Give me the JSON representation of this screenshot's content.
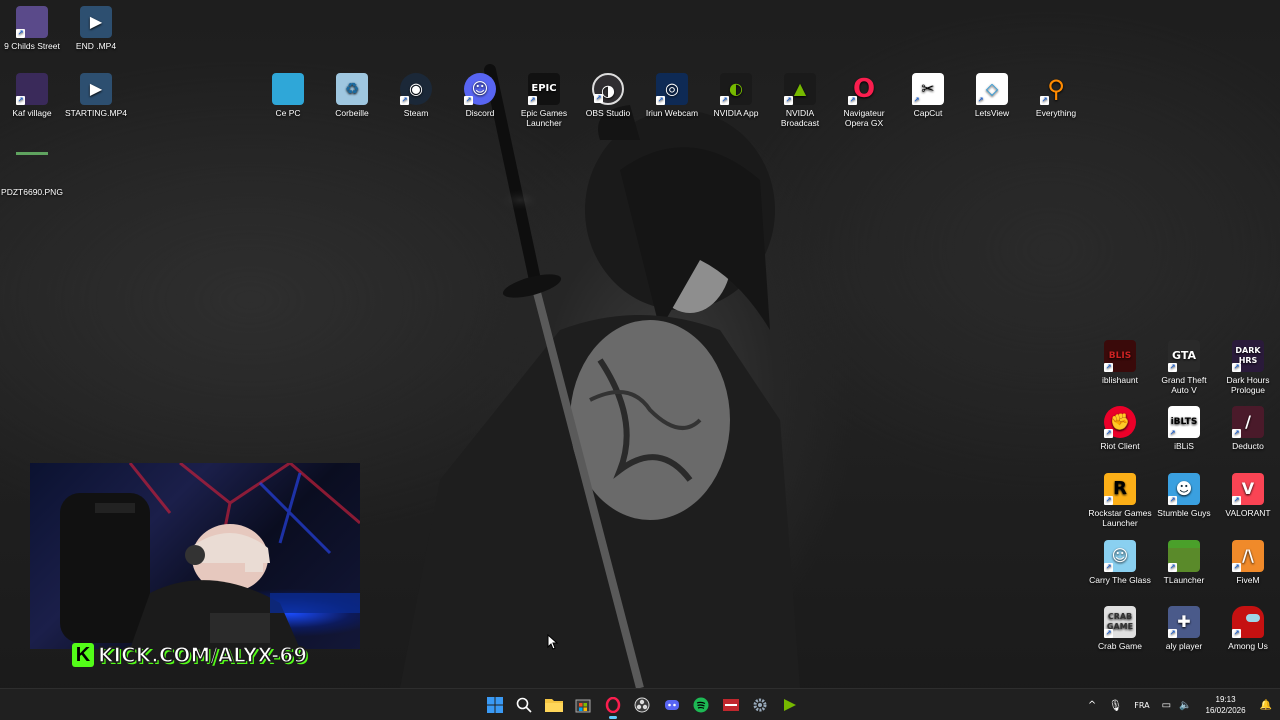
{
  "desktop": {
    "left_icons": [
      {
        "label": "9 Childs Street",
        "icon": "game-icon",
        "color": "#5a4a8a"
      },
      {
        "label": "END .MP4",
        "icon": "video-file-icon",
        "color": "#2d4f70"
      },
      {
        "label": "Kaf village",
        "icon": "game-icon",
        "color": "#3a2a5a"
      },
      {
        "label": "STARTING.MP4",
        "icon": "video-file-icon",
        "color": "#2d4f70"
      },
      {
        "label": "PDZT6690.PNG",
        "icon": "image-file-icon",
        "color": "#3a3a3a"
      }
    ],
    "top_icons": [
      {
        "label": "Ce PC",
        "icon": "monitor-icon",
        "color": "#2fa7d8"
      },
      {
        "label": "Corbeille",
        "icon": "recycle-bin-icon",
        "color": "#9fc7e0"
      },
      {
        "label": "Steam",
        "icon": "steam-icon",
        "color": "#1b2838"
      },
      {
        "label": "Discord",
        "icon": "discord-icon",
        "color": "#5865f2"
      },
      {
        "label": "Epic Games Launcher",
        "icon": "epic-games-icon",
        "color": "#111111"
      },
      {
        "label": "OBS Studio",
        "icon": "obs-icon",
        "color": "#302e31"
      },
      {
        "label": "Iriun Webcam",
        "icon": "webcam-icon",
        "color": "#0e2a55"
      },
      {
        "label": "NVIDIA App",
        "icon": "nvidia-icon",
        "color": "#76b900"
      },
      {
        "label": "NVIDIA Broadcast",
        "icon": "nvidia-broadcast-icon",
        "color": "#1a1a1a"
      },
      {
        "label": "Navigateur Opera GX",
        "icon": "opera-gx-icon",
        "color": "#fa1e4e"
      },
      {
        "label": "CapCut",
        "icon": "capcut-icon",
        "color": "#ffffff"
      },
      {
        "label": "LetsView",
        "icon": "letsview-icon",
        "color": "#ffffff"
      },
      {
        "label": "Everything",
        "icon": "search-magnifier-icon",
        "color": "#ff8a00"
      }
    ],
    "right_icons": [
      {
        "label": "iblishaunt",
        "icon": "game-icon",
        "color": "#3a0a0a"
      },
      {
        "label": "Grand Theft Auto V",
        "icon": "gta-icon",
        "color": "#2a2a2a"
      },
      {
        "label": "Dark Hours Prologue",
        "icon": "game-icon",
        "color": "#2a1a3a"
      },
      {
        "label": "Riot Client",
        "icon": "riot-icon",
        "color": "#eb0029"
      },
      {
        "label": "iBLiS",
        "icon": "game-icon",
        "color": "#ffffff"
      },
      {
        "label": "Deducto",
        "icon": "game-icon",
        "color": "#4a1a2a"
      },
      {
        "label": "Rockstar Games Launcher",
        "icon": "rockstar-icon",
        "color": "#fcaf17"
      },
      {
        "label": "Stumble Guys",
        "icon": "game-icon",
        "color": "#3aa0e0"
      },
      {
        "label": "VALORANT",
        "icon": "valorant-icon",
        "color": "#fa4454"
      },
      {
        "label": "Carry The Glass",
        "icon": "game-icon",
        "color": "#8ad0f0"
      },
      {
        "label": "TLauncher",
        "icon": "minecraft-icon",
        "color": "#5a8a2a"
      },
      {
        "label": "FiveM",
        "icon": "fivem-icon",
        "color": "#f08a2a"
      },
      {
        "label": "Crab Game",
        "icon": "game-icon",
        "color": "#e0e0e0"
      },
      {
        "label": "aly player",
        "icon": "gamepad-icon",
        "color": "#4a5a8a"
      },
      {
        "label": "Among Us",
        "icon": "among-us-icon",
        "color": "#c51111"
      }
    ]
  },
  "overlay": {
    "kick_url": "KICK.COM/ALYX-69",
    "kick_logo_letter": "K",
    "kick_color": "#53fc18"
  },
  "taskbar": {
    "apps": [
      {
        "name": "start-button",
        "icon": "windows-icon",
        "color": "#3a9af5",
        "glyph": "⊞",
        "active": false
      },
      {
        "name": "search-button",
        "icon": "search-icon",
        "color": "transparent",
        "glyph": "⌕",
        "active": false
      },
      {
        "name": "file-explorer-button",
        "icon": "folder-icon",
        "color": "#f5c542",
        "glyph": "",
        "active": false
      },
      {
        "name": "microsoft-store-button",
        "icon": "store-icon",
        "color": "#2a2a2a",
        "glyph": "▦",
        "active": false
      },
      {
        "name": "opera-gx-button",
        "icon": "opera-gx-icon",
        "color": "#fa1e4e",
        "glyph": "O",
        "active": true
      },
      {
        "name": "obs-button",
        "icon": "obs-icon",
        "color": "#3a3a3a",
        "glyph": "◎",
        "active": false
      },
      {
        "name": "discord-button",
        "icon": "discord-icon",
        "color": "#5865f2",
        "glyph": "◉",
        "active": false
      },
      {
        "name": "spotify-button",
        "icon": "spotify-icon",
        "color": "#1db954",
        "glyph": "≋",
        "active": false
      },
      {
        "name": "app-button",
        "icon": "app-icon",
        "color": "#c0272d",
        "glyph": "▭",
        "active": false
      },
      {
        "name": "settings-button",
        "icon": "gear-icon",
        "color": "#5a6a7a",
        "glyph": "⚙",
        "active": false
      },
      {
        "name": "nvidia-broadcast-button",
        "icon": "nvidia-broadcast-icon",
        "color": "#76b900",
        "glyph": "▶",
        "active": false
      }
    ],
    "tray": {
      "chevron": "^",
      "mic": "🎙",
      "language": "FRA",
      "network": "▭",
      "volume": "🔈",
      "time": "19:13",
      "date": "16/02/2026",
      "notification": "🔔"
    }
  }
}
